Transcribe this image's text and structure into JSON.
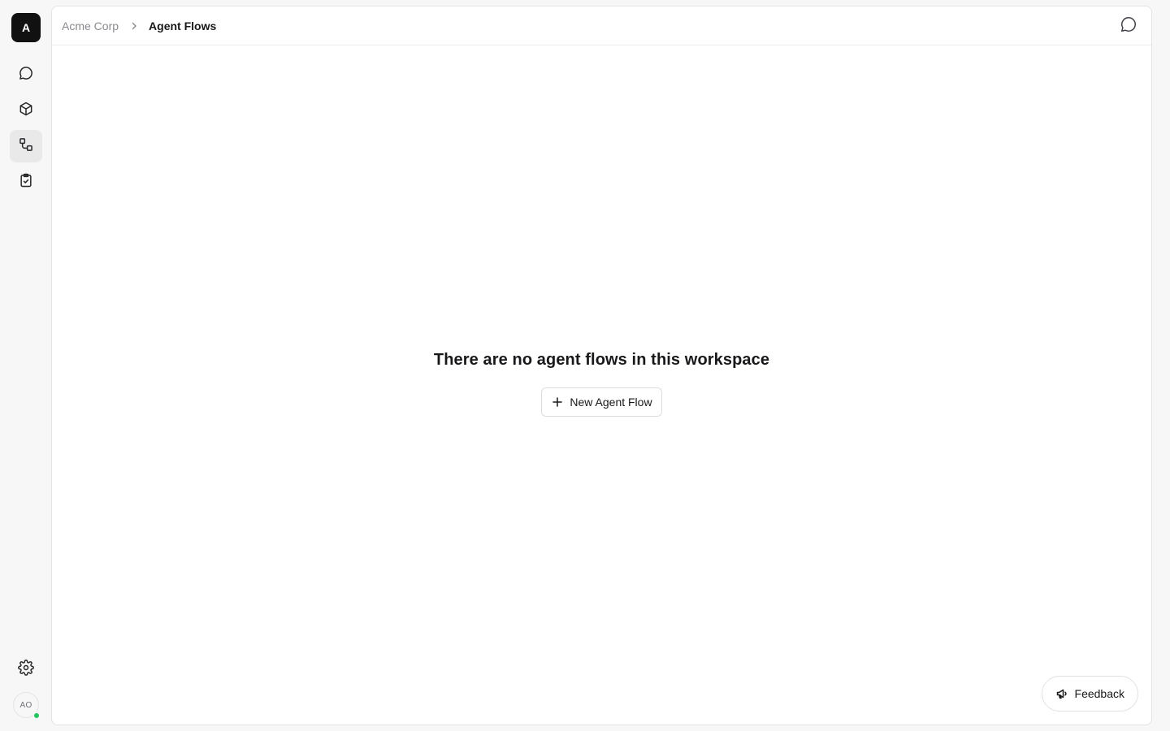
{
  "workspace": {
    "initial": "A"
  },
  "rail": {
    "items": [
      {
        "name": "chat",
        "icon": "chat-bubble-icon"
      },
      {
        "name": "models",
        "icon": "cube-icon"
      },
      {
        "name": "agent-flows",
        "icon": "flow-icon",
        "active": true
      },
      {
        "name": "tasks",
        "icon": "clipboard-check-icon"
      }
    ],
    "settings_icon": "gear-icon",
    "user_initials": "AO",
    "status_color": "#22c55e"
  },
  "breadcrumb": {
    "root": "Acme Corp",
    "current": "Agent Flows"
  },
  "header": {
    "chat_icon": "chat-bubble-icon"
  },
  "empty_state": {
    "title": "There are no agent flows in this workspace",
    "button_label": "New Agent Flow"
  },
  "feedback": {
    "label": "Feedback"
  },
  "colors": {
    "accent_dark": "#111111",
    "active_bg": "#e9e9ea",
    "border": "#e4e4e7"
  }
}
